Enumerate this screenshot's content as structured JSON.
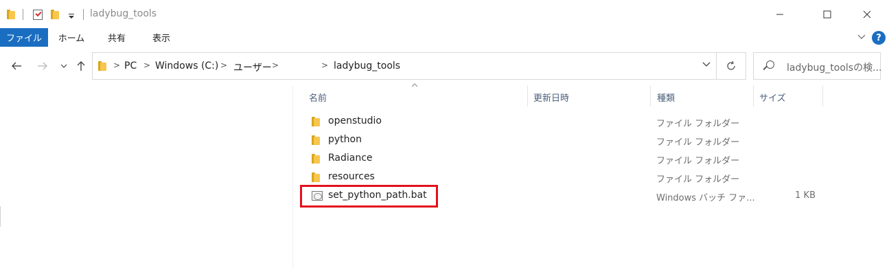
{
  "window": {
    "title": "ladybug_tools",
    "minimize": "—",
    "maximize": "☐",
    "close": "✕"
  },
  "ribbon": {
    "tabs": [
      "ファイル",
      "ホーム",
      "共有",
      "表示"
    ],
    "help": "?",
    "expand": "∨"
  },
  "nav": {
    "back": "←",
    "forward": "→",
    "recent": "∨",
    "up": "↑"
  },
  "address": {
    "crumbs": [
      "PC",
      "Windows (C:)",
      "ユーザー",
      "ladybug_tools"
    ],
    "separator": ">",
    "dropdown": "∨",
    "refresh": "↻"
  },
  "search": {
    "placeholder": "ladybug_toolsの検..."
  },
  "columns": {
    "name": "名前",
    "date": "更新日時",
    "type": "種類",
    "size": "サイズ",
    "sort_indicator": "^"
  },
  "files": [
    {
      "name": "openstudio",
      "type": "ファイル フォルダー",
      "size": "",
      "icon": "folder-icon"
    },
    {
      "name": "python",
      "type": "ファイル フォルダー",
      "size": "",
      "icon": "folder-icon"
    },
    {
      "name": "Radiance",
      "type": "ファイル フォルダー",
      "size": "",
      "icon": "folder-icon"
    },
    {
      "name": "resources",
      "type": "ファイル フォルダー",
      "size": "",
      "icon": "folder-icon"
    },
    {
      "name": "set_python_path.bat",
      "type": "Windows バッチ ファ...",
      "size": "1 KB",
      "icon": "batch-file-icon"
    }
  ],
  "colors": {
    "accent": "#1a6ec1",
    "highlight": "#e3101c",
    "folder": "#f7c64c"
  }
}
